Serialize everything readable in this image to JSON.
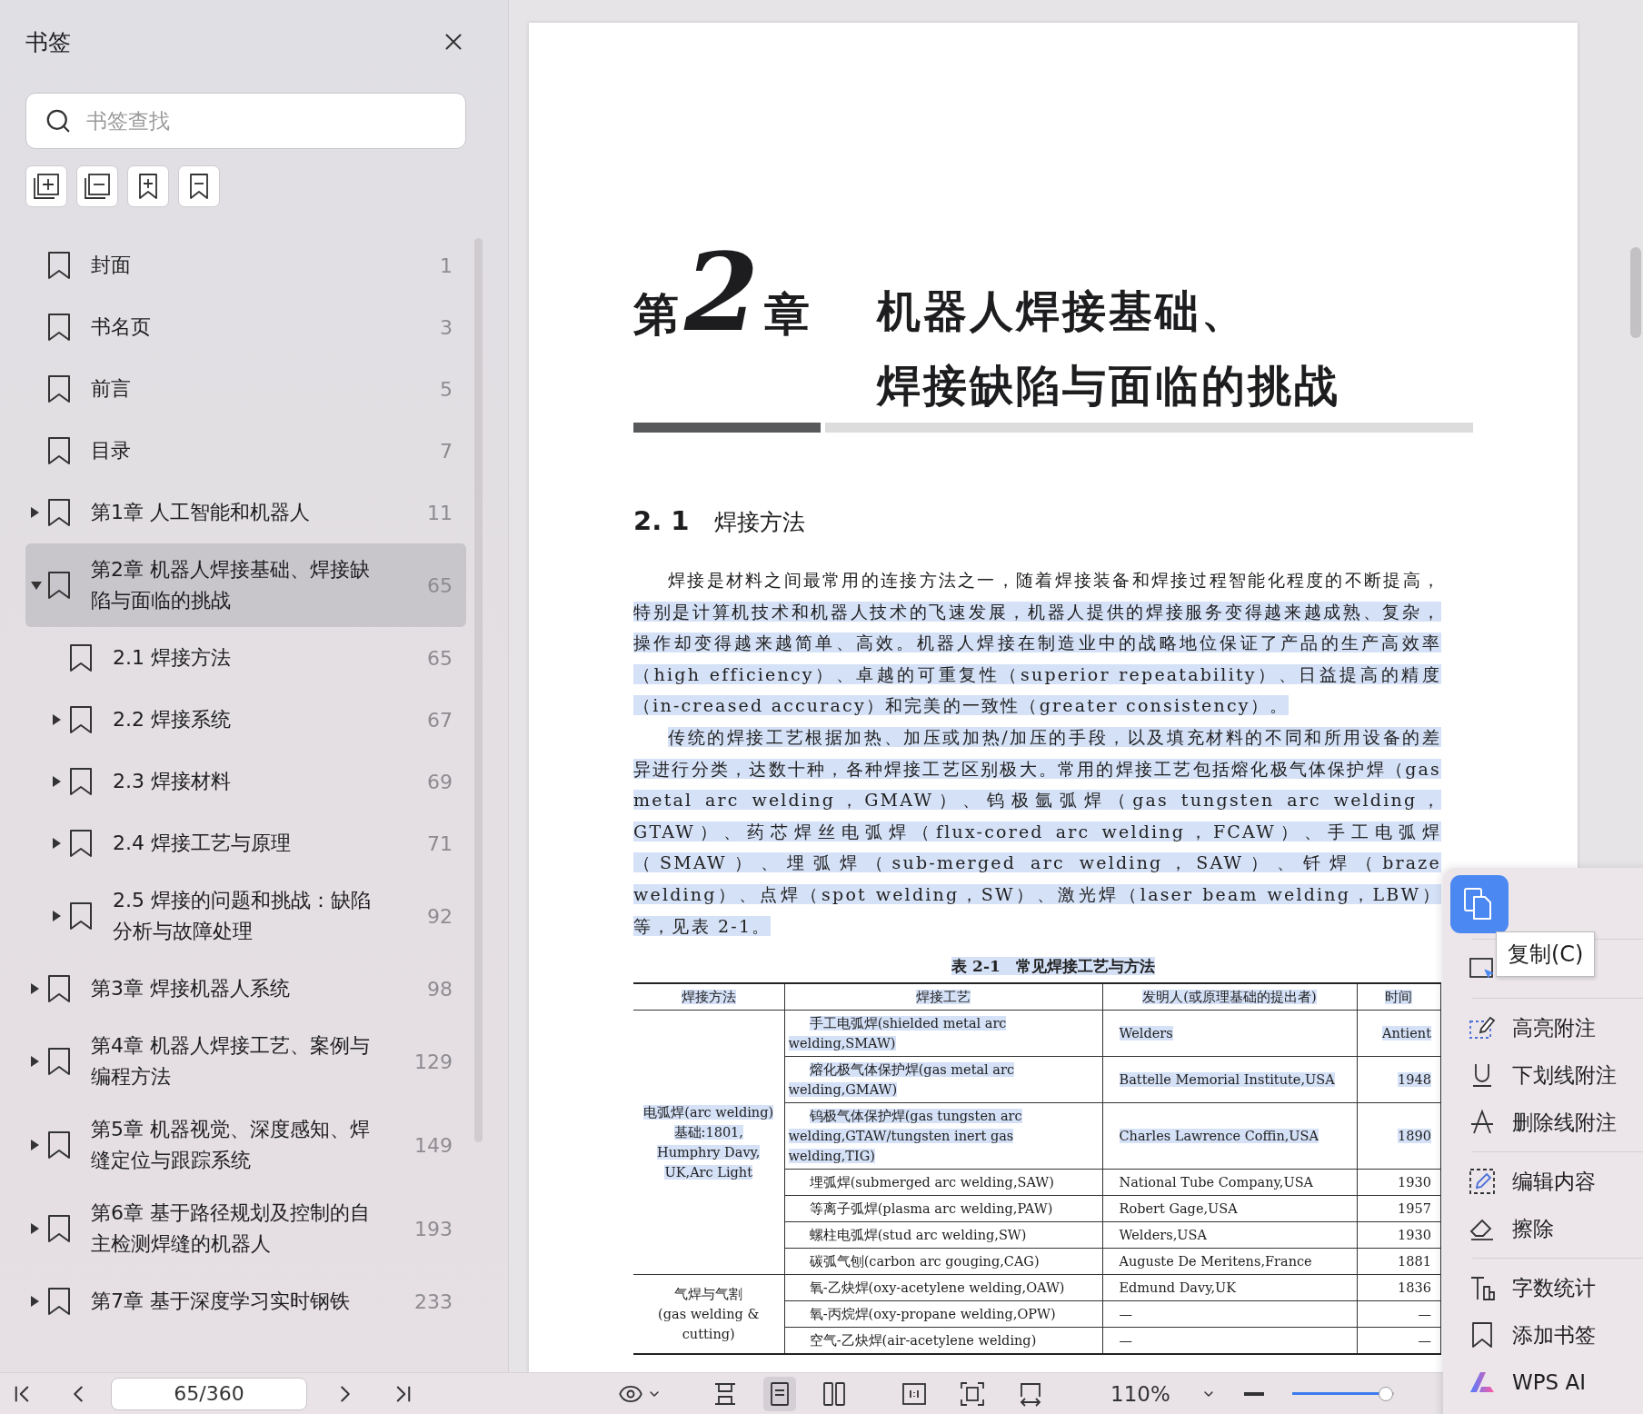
{
  "sidebar": {
    "title": "书签",
    "search": {
      "placeholder": "书签查找"
    },
    "bookmarks": [
      {
        "label": "封面",
        "page": "1",
        "kind": "leaf",
        "selected": false
      },
      {
        "label": "书名页",
        "page": "3",
        "kind": "leaf",
        "selected": false
      },
      {
        "label": "前言",
        "page": "5",
        "kind": "leaf",
        "selected": false
      },
      {
        "label": "目录",
        "page": "7",
        "kind": "leaf",
        "selected": false
      },
      {
        "label": "第1章 人工智能和机器人",
        "page": "11",
        "kind": "folder",
        "expanded": false,
        "selected": false
      },
      {
        "label": "第2章 机器人焊接基础、焊接缺陷与面临的挑战",
        "page": "65",
        "kind": "folder",
        "expanded": true,
        "selected": true,
        "children": [
          {
            "label": "2.1 焊接方法",
            "page": "65",
            "kind": "leaf",
            "selected": false
          },
          {
            "label": "2.2 焊接系统",
            "page": "67",
            "kind": "folder",
            "expanded": false,
            "selected": false
          },
          {
            "label": "2.3 焊接材料",
            "page": "69",
            "kind": "folder",
            "expanded": false,
            "selected": false
          },
          {
            "label": "2.4 焊接工艺与原理",
            "page": "71",
            "kind": "folder",
            "expanded": false,
            "selected": false
          },
          {
            "label": "2.5 焊接的问题和挑战：缺陷分析与故障处理",
            "page": "92",
            "kind": "folder",
            "expanded": false,
            "selected": false
          }
        ]
      },
      {
        "label": "第3章 焊接机器人系统",
        "page": "98",
        "kind": "folder",
        "expanded": false,
        "selected": false
      },
      {
        "label": "第4章 机器人焊接工艺、案例与编程方法",
        "page": "129",
        "kind": "folder",
        "expanded": false,
        "selected": false
      },
      {
        "label": "第5章 机器视觉、深度感知、焊缝定位与跟踪系统",
        "page": "149",
        "kind": "folder",
        "expanded": false,
        "selected": false
      },
      {
        "label": "第6章 基于路径规划及控制的自主检测焊缝的机器人",
        "page": "193",
        "kind": "folder",
        "expanded": false,
        "selected": false
      },
      {
        "label": "第7章 基于深度学习实时钢铁",
        "page": "233",
        "kind": "folder",
        "expanded": false,
        "selected": false
      }
    ]
  },
  "document": {
    "chapter": {
      "prefix": "第",
      "number": "2",
      "suffix": "章",
      "title_lines": [
        "机器人焊接基础、",
        "焊接缺陷与面临的挑战"
      ]
    },
    "section": {
      "number": "2. 1",
      "title": "焊接方法"
    },
    "paragraphs": [
      {
        "segments": [
          {
            "text": "焊接是材料之间最常用的连接方法之一，随着焊接装备和焊接过程智能化程度的不断提高，",
            "selected": false
          },
          {
            "text": "特别是计算机技术和机器人技术的飞速发展，机器人提供的焊接服务变得越来越成熟、复杂，操作却变得越来越简单、高效。机器人焊接在制造业中的战略地位保证了产品的生产高效率（high efficiency）、卓越的可重复性（superior repeatability）、日益提高的精度（in-creased accuracy）和完美的一致性（greater consistency）。",
            "selected": true
          }
        ]
      },
      {
        "segments": [
          {
            "text": "传统的焊接工艺根据加热、加压或加热/加压的手段，以及填充材料的不同和所用设备的差异进行分类，达数十种，各种焊接工艺区别极大。常用的焊接工艺包括熔化极气体保护焊（gas metal arc welding，GMAW）、钨极氩弧焊（gas tungsten arc welding，GTAW）、药芯焊丝电弧焊（flux-cored arc welding，FCAW）、手工电弧焊（SMAW）、埋弧焊（sub-merged arc welding，SAW）、钎焊（braze welding）、点焊（spot welding，SW）、激光焊（laser beam welding，LBW）等，见表 2-1。",
            "selected": true
          }
        ]
      }
    ],
    "table": {
      "caption": {
        "text": "表 2-1　常见焊接工艺与方法",
        "selected": true
      },
      "columns": [
        {
          "label": "焊接方法",
          "selected": true
        },
        {
          "label": "焊接工艺",
          "selected": true
        },
        {
          "label": "发明人(或原理基础的提出者)",
          "selected": true
        },
        {
          "label": "时间",
          "selected": true
        }
      ],
      "groups": [
        {
          "method": {
            "lines": [
              "电弧焊(arc welding)",
              "基础:1801,",
              "Humphry Davy,",
              "UK,Arc Light"
            ],
            "selected": true
          },
          "rows": [
            {
              "process": {
                "text": "手工电弧焊(shielded metal arc welding,SMAW)",
                "selected": true
              },
              "inventor": {
                "text": "Welders",
                "selected": true
              },
              "time": {
                "text": "Antient",
                "selected": true
              }
            },
            {
              "process": {
                "text": "熔化极气体保护焊(gas metal arc welding,GMAW)",
                "selected": true
              },
              "inventor": {
                "text": "Battelle Memorial Institute,USA",
                "selected": true
              },
              "time": {
                "text": "1948",
                "selected": true
              }
            },
            {
              "process": {
                "text": "钨极气体保护焊(gas tungsten arc welding,GTAW/tungsten inert gas welding,TIG)",
                "selected": true
              },
              "inventor": {
                "text": "Charles Lawrence Coffin,USA",
                "selected": true
              },
              "time": {
                "text": "1890",
                "selected": true
              }
            },
            {
              "process": {
                "text": "埋弧焊(submerged arc welding,SAW)",
                "selected": false
              },
              "inventor": {
                "text": "National Tube Company,USA",
                "selected": false
              },
              "time": {
                "text": "1930",
                "selected": false
              }
            },
            {
              "process": {
                "text": "等离子弧焊(plasma arc welding,PAW)",
                "selected": false
              },
              "inventor": {
                "text": "Robert Gage,USA",
                "selected": false
              },
              "time": {
                "text": "1957",
                "selected": false
              }
            },
            {
              "process": {
                "text": "螺柱电弧焊(stud arc welding,SW)",
                "selected": false
              },
              "inventor": {
                "text": "Welders,USA",
                "selected": false
              },
              "time": {
                "text": "1930",
                "selected": false
              }
            },
            {
              "process": {
                "text": "碳弧气刨(carbon arc gouging,CAG)",
                "selected": false
              },
              "inventor": {
                "text": "Auguste De Meritens,France",
                "selected": false
              },
              "time": {
                "text": "1881",
                "selected": false
              }
            }
          ]
        },
        {
          "method": {
            "lines": [
              "气焊与气割",
              "(gas welding &",
              "cutting)"
            ],
            "selected": false
          },
          "rows": [
            {
              "process": {
                "text": "氧-乙炔焊(oxy-acetylene welding,OAW)",
                "selected": false
              },
              "inventor": {
                "text": "Edmund Davy,UK",
                "selected": false
              },
              "time": {
                "text": "1836",
                "selected": false
              }
            },
            {
              "process": {
                "text": "氧-丙烷焊(oxy-propane welding,OPW)",
                "selected": false
              },
              "inventor": {
                "text": "—",
                "selected": false
              },
              "time": {
                "text": "—",
                "selected": false
              }
            },
            {
              "process": {
                "text": "空气-乙炔焊(air-acetylene welding)",
                "selected": false
              },
              "inventor": {
                "text": "—",
                "selected": false
              },
              "time": {
                "text": "—",
                "selected": false
              }
            }
          ]
        }
      ]
    }
  },
  "context_menu": {
    "copy_tooltip": "复制(C)",
    "groups": [
      [
        {
          "kind": "select"
        }
      ],
      [
        {
          "kind": "highlight",
          "label": "高亮附注"
        },
        {
          "kind": "underline",
          "label": "下划线附注"
        },
        {
          "kind": "strike",
          "label": "删除线附注"
        }
      ],
      [
        {
          "kind": "edit",
          "label": "编辑内容"
        },
        {
          "kind": "erase",
          "label": "擦除"
        }
      ],
      [
        {
          "kind": "count",
          "label": "字数统计"
        },
        {
          "kind": "bookmark",
          "label": "添加书签"
        },
        {
          "kind": "ai",
          "label": "WPS AI"
        }
      ]
    ]
  },
  "toolbar": {
    "page_field": "65/360",
    "zoom": "110%",
    "zoom_slider": {
      "level": 0.92
    },
    "view_tools": [
      {
        "kind": "continuous",
        "selected": false
      },
      {
        "kind": "single",
        "selected": true
      },
      {
        "kind": "double",
        "selected": false
      }
    ],
    "fit_tools": [
      {
        "kind": "actual"
      },
      {
        "kind": "fit"
      },
      {
        "kind": "width"
      }
    ]
  }
}
